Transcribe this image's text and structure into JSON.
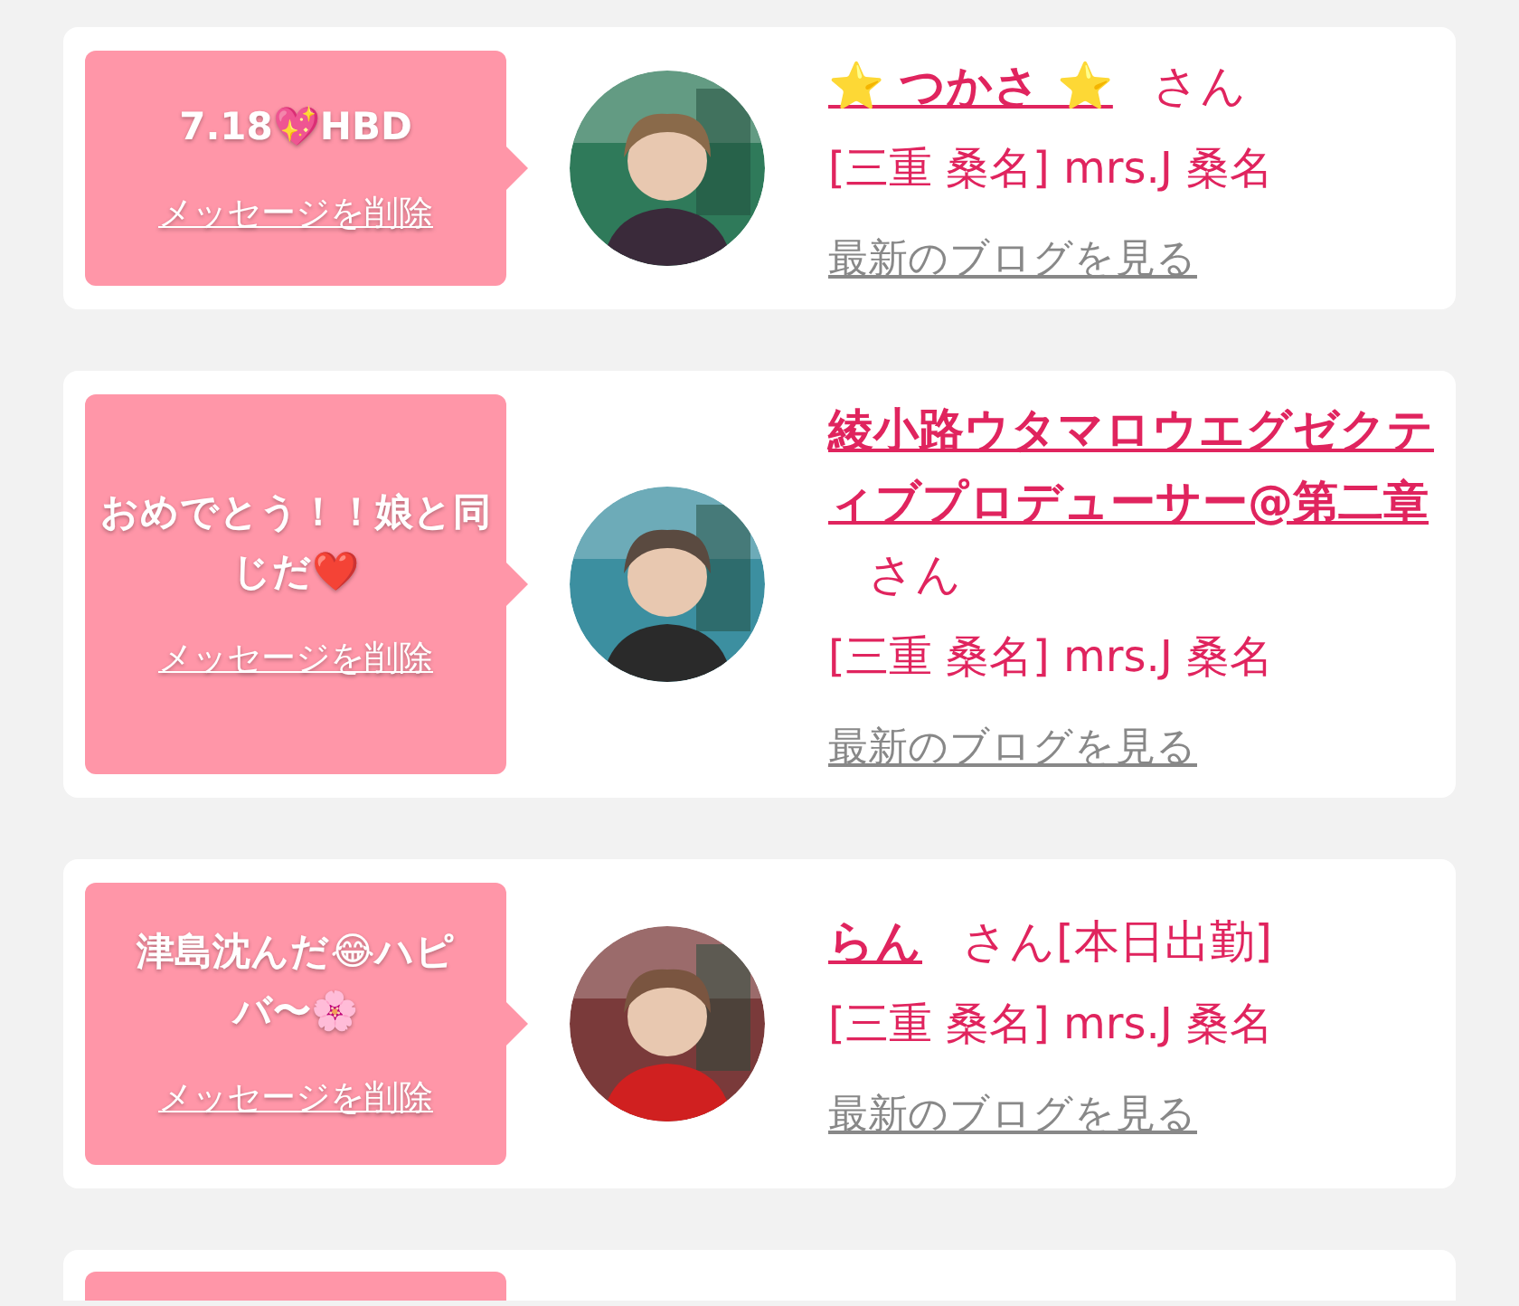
{
  "messages": [
    {
      "message": "7.18💖HBD",
      "delete_link": "メッセージを削除",
      "name": "⭐ つかさ ⭐",
      "honorific": "さん",
      "location": "[三重 桑名] mrs.J 桑名",
      "blog_link": "最新のブログを見る"
    },
    {
      "message": "おめでとう！！娘と同じだ❤️",
      "delete_link": "メッセージを削除",
      "name": "綾小路ウタマロウエグゼクティブプロデューサー@第二章",
      "honorific": "さん",
      "location": "[三重 桑名] mrs.J 桑名",
      "blog_link": "最新のブログを見る"
    },
    {
      "message": "津島沈んだ😂ハピバ〜🌸",
      "delete_link": "メッセージを削除",
      "name": "らん",
      "honorific": "さん[本日出勤]",
      "location": "[三重 桑名] mrs.J 桑名",
      "blog_link": "最新のブログを見る"
    }
  ]
}
